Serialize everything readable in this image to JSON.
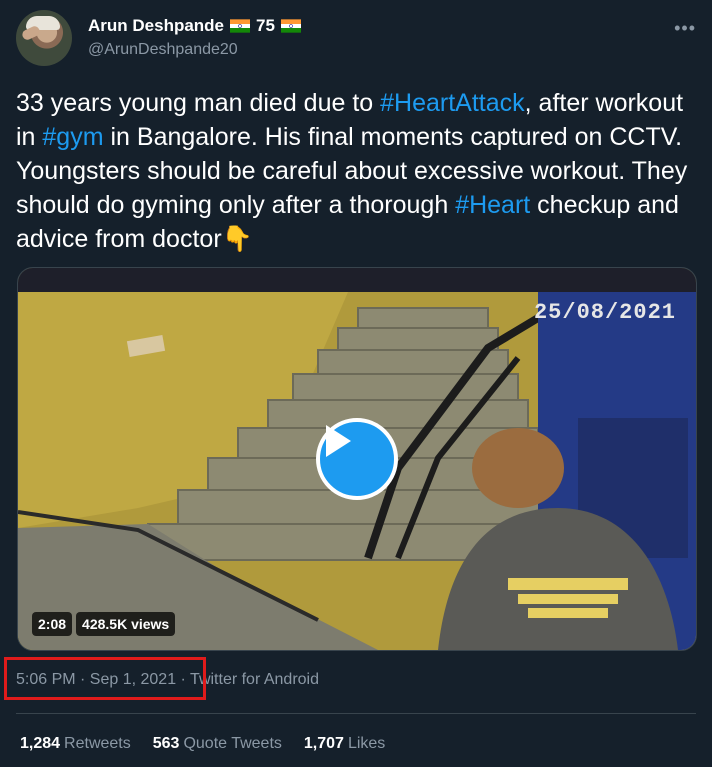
{
  "author": {
    "name": "Arun Deshpande",
    "badge_text": "75",
    "handle": "@ArunDeshpande20"
  },
  "tweet": {
    "text_parts": [
      "33 years young man died due to ",
      "#HeartAttack",
      ", after workout in ",
      "#gym",
      " in Bangalore. His final moments captured on CCTV. Youngsters should be careful about excessive workout. They should do gyming only after a thorough ",
      "#Heart",
      " checkup and advice from doctor",
      "👇"
    ]
  },
  "media": {
    "overlay_date": "25/08/2021",
    "duration": "2:08",
    "views": "428.5K views"
  },
  "meta": {
    "time": "5:06 PM · Sep 1, 2021",
    "separator": " · ",
    "source": "Twitter for Android"
  },
  "stats": {
    "retweets_count": "1,284",
    "retweets_label": "Retweets",
    "quotes_count": "563",
    "quotes_label": "Quote Tweets",
    "likes_count": "1,707",
    "likes_label": "Likes"
  },
  "colors": {
    "background": "#15202b",
    "accent": "#1d9bf0",
    "secondary_text": "#8b98a5",
    "highlight_box": "#e01b1b"
  }
}
